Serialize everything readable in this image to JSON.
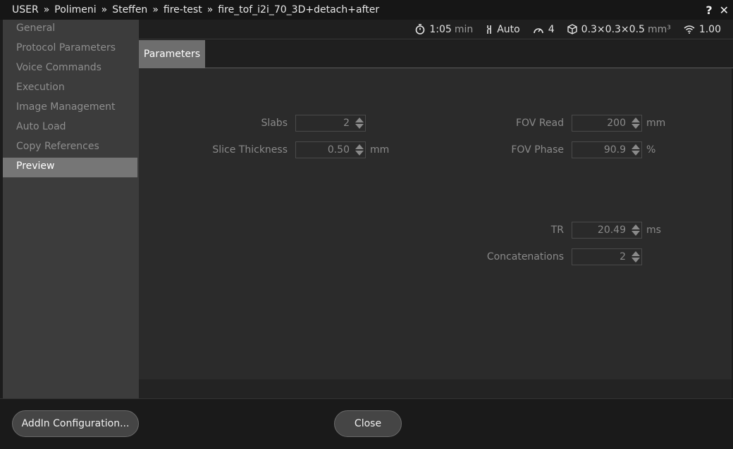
{
  "titlebar": {
    "crumbs": [
      "USER",
      "Polimeni",
      "Steffen",
      "fire-test",
      "fire_tof_i2i_70_3D+detach+after"
    ],
    "separator": "»",
    "help": "?",
    "close": "✕"
  },
  "sidebar": {
    "items": [
      {
        "label": "General"
      },
      {
        "label": "Protocol Parameters"
      },
      {
        "label": "Voice Commands"
      },
      {
        "label": "Execution"
      },
      {
        "label": "Image Management"
      },
      {
        "label": "Auto Load"
      },
      {
        "label": "Copy References"
      },
      {
        "label": "Preview",
        "active": true
      }
    ]
  },
  "status": {
    "time_value": "1:05",
    "time_unit": "min",
    "mode": "Auto",
    "speed": "4",
    "resolution": "0.3×0.3×0.5",
    "resolution_unit": "mm³",
    "snr": "1.00"
  },
  "tabs": [
    {
      "label": "Parameters"
    }
  ],
  "params": {
    "slabs": {
      "label": "Slabs",
      "value": "2",
      "unit": ""
    },
    "slice_thickness": {
      "label": "Slice Thickness",
      "value": "0.50",
      "unit": "mm"
    },
    "fov_read": {
      "label": "FOV Read",
      "value": "200",
      "unit": "mm"
    },
    "fov_phase": {
      "label": "FOV Phase",
      "value": "90.9",
      "unit": "%"
    },
    "tr": {
      "label": "TR",
      "value": "20.49",
      "unit": "ms"
    },
    "concatenations": {
      "label": "Concatenations",
      "value": "2",
      "unit": ""
    }
  },
  "footer": {
    "addin_label": "AddIn Configuration...",
    "close_label": "Close"
  }
}
